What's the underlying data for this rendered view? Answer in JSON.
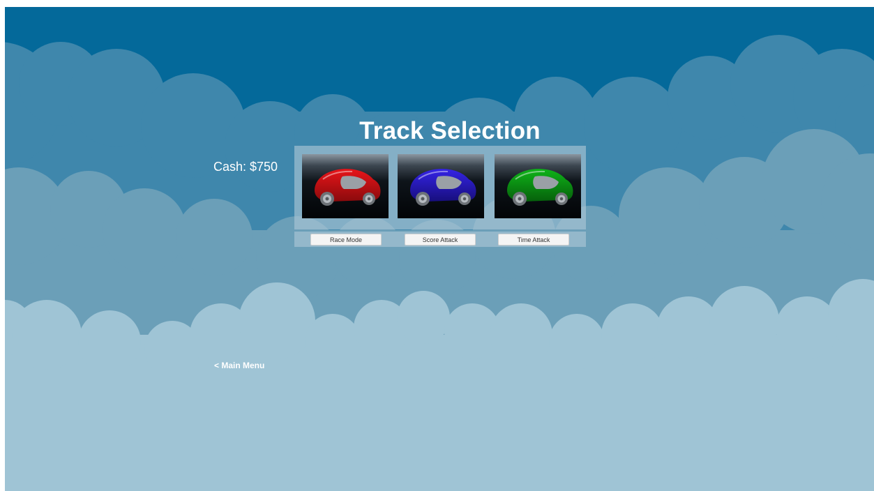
{
  "screen": {
    "title": "Track Selection",
    "cash_label": "Cash: $750",
    "back_link": "< Main Menu"
  },
  "tracks": [
    {
      "car_color": "#e8151a",
      "car_dark": "#8a0a0c",
      "car_name": "red-car-icon"
    },
    {
      "car_color": "#3524e6",
      "car_dark": "#170e7c",
      "car_name": "blue-car-icon"
    },
    {
      "car_color": "#0fb419",
      "car_dark": "#06600b",
      "car_name": "green-car-icon"
    }
  ],
  "modes": [
    {
      "label": "Race Mode"
    },
    {
      "label": "Score Attack"
    },
    {
      "label": "Time Attack"
    }
  ],
  "colors": {
    "sky": "#04699a",
    "cloud_layer_1": "#3f87ac",
    "cloud_layer_2": "#6b9fb8",
    "cloud_layer_3": "#9fc4d5",
    "text": "#ffffff"
  }
}
